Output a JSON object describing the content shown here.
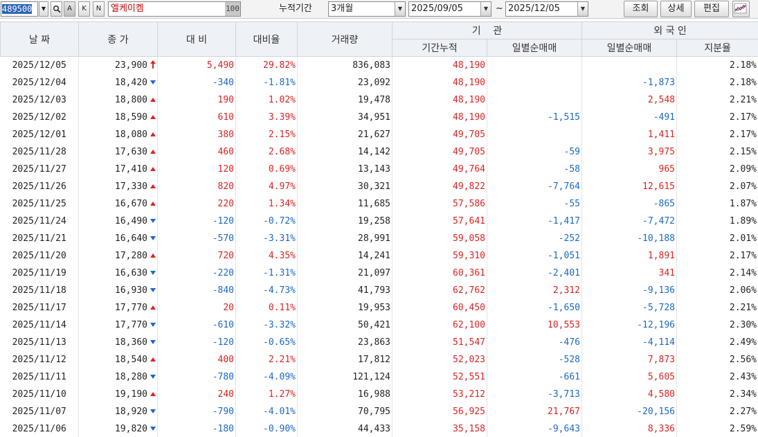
{
  "toolbar": {
    "stock_code": "489500",
    "stock_name": "엘케이켐",
    "name_field_value": "100",
    "btn_search_icon": "magnifier-icon",
    "btn_a": "A",
    "btn_k": "K",
    "btn_n": "N",
    "period_label": "누적기간",
    "period_value": "3개월",
    "from_date": "2025/09/05",
    "tilde": "~",
    "to_date": "2025/12/05",
    "query_button": "조회",
    "detail_button": "상세",
    "edit_button": "편집",
    "chart_icon": "line-chart-icon"
  },
  "columns": {
    "date": "날 짜",
    "close": "종 가",
    "change": "대 비",
    "change_rate": "대비율",
    "volume": "거래량",
    "institution": "기    관",
    "inst_cumulative": "기간누적",
    "inst_daily": "일별순매매",
    "foreign": "외 국 인",
    "foreign_daily": "일별순매매",
    "foreign_holding": "지분율"
  },
  "colors": {
    "up": "#e02020",
    "down": "#1a68c9",
    "header_bg": "#eef1f6"
  },
  "rows": [
    {
      "date": "2025/12/05",
      "close": "23,900",
      "dir": "limit",
      "change": "5,490",
      "rate": "29.82%",
      "volume": "836,083",
      "inst_cum": "48,190",
      "inst_daily": "",
      "frn_daily": "",
      "frn_hold": "2.18%"
    },
    {
      "date": "2025/12/04",
      "close": "18,420",
      "dir": "down",
      "change": "-340",
      "rate": "-1.81%",
      "volume": "23,092",
      "inst_cum": "48,190",
      "inst_daily": "",
      "frn_daily": "-1,873",
      "frn_hold": "2.18%"
    },
    {
      "date": "2025/12/03",
      "close": "18,800",
      "dir": "up",
      "change": "190",
      "rate": "1.02%",
      "volume": "19,478",
      "inst_cum": "48,190",
      "inst_daily": "",
      "frn_daily": "2,548",
      "frn_hold": "2.21%"
    },
    {
      "date": "2025/12/02",
      "close": "18,590",
      "dir": "up",
      "change": "610",
      "rate": "3.39%",
      "volume": "34,951",
      "inst_cum": "48,190",
      "inst_daily": "-1,515",
      "frn_daily": "-491",
      "frn_hold": "2.17%"
    },
    {
      "date": "2025/12/01",
      "close": "18,080",
      "dir": "up",
      "change": "380",
      "rate": "2.15%",
      "volume": "21,627",
      "inst_cum": "49,705",
      "inst_daily": "",
      "frn_daily": "1,411",
      "frn_hold": "2.17%"
    },
    {
      "date": "2025/11/28",
      "close": "17,630",
      "dir": "up",
      "change": "460",
      "rate": "2.68%",
      "volume": "14,142",
      "inst_cum": "49,705",
      "inst_daily": "-59",
      "frn_daily": "3,975",
      "frn_hold": "2.15%"
    },
    {
      "date": "2025/11/27",
      "close": "17,410",
      "dir": "up",
      "change": "120",
      "rate": "0.69%",
      "volume": "13,143",
      "inst_cum": "49,764",
      "inst_daily": "-58",
      "frn_daily": "965",
      "frn_hold": "2.09%"
    },
    {
      "date": "2025/11/26",
      "close": "17,330",
      "dir": "up",
      "change": "820",
      "rate": "4.97%",
      "volume": "30,321",
      "inst_cum": "49,822",
      "inst_daily": "-7,764",
      "frn_daily": "12,615",
      "frn_hold": "2.07%"
    },
    {
      "date": "2025/11/25",
      "close": "16,670",
      "dir": "up",
      "change": "220",
      "rate": "1.34%",
      "volume": "11,685",
      "inst_cum": "57,586",
      "inst_daily": "-55",
      "frn_daily": "-865",
      "frn_hold": "1.87%"
    },
    {
      "date": "2025/11/24",
      "close": "16,490",
      "dir": "down",
      "change": "-120",
      "rate": "-0.72%",
      "volume": "19,258",
      "inst_cum": "57,641",
      "inst_daily": "-1,417",
      "frn_daily": "-7,472",
      "frn_hold": "1.89%"
    },
    {
      "date": "2025/11/21",
      "close": "16,640",
      "dir": "down",
      "change": "-570",
      "rate": "-3.31%",
      "volume": "28,991",
      "inst_cum": "59,058",
      "inst_daily": "-252",
      "frn_daily": "-10,188",
      "frn_hold": "2.01%"
    },
    {
      "date": "2025/11/20",
      "close": "17,280",
      "dir": "up",
      "change": "720",
      "rate": "4.35%",
      "volume": "14,241",
      "inst_cum": "59,310",
      "inst_daily": "-1,051",
      "frn_daily": "1,891",
      "frn_hold": "2.17%"
    },
    {
      "date": "2025/11/19",
      "close": "16,630",
      "dir": "down",
      "change": "-220",
      "rate": "-1.31%",
      "volume": "21,097",
      "inst_cum": "60,361",
      "inst_daily": "-2,401",
      "frn_daily": "341",
      "frn_hold": "2.14%"
    },
    {
      "date": "2025/11/18",
      "close": "16,930",
      "dir": "down",
      "change": "-840",
      "rate": "-4.73%",
      "volume": "41,793",
      "inst_cum": "62,762",
      "inst_daily": "2,312",
      "frn_daily": "-9,136",
      "frn_hold": "2.06%"
    },
    {
      "date": "2025/11/17",
      "close": "17,770",
      "dir": "up",
      "change": "20",
      "rate": "0.11%",
      "volume": "19,953",
      "inst_cum": "60,450",
      "inst_daily": "-1,650",
      "frn_daily": "-5,728",
      "frn_hold": "2.21%"
    },
    {
      "date": "2025/11/14",
      "close": "17,770",
      "dir": "down",
      "change": "-610",
      "rate": "-3.32%",
      "volume": "50,421",
      "inst_cum": "62,100",
      "inst_daily": "10,553",
      "frn_daily": "-12,196",
      "frn_hold": "2.30%"
    },
    {
      "date": "2025/11/13",
      "close": "18,360",
      "dir": "down",
      "change": "-120",
      "rate": "-0.65%",
      "volume": "23,863",
      "inst_cum": "51,547",
      "inst_daily": "-476",
      "frn_daily": "-4,114",
      "frn_hold": "2.49%"
    },
    {
      "date": "2025/11/12",
      "close": "18,540",
      "dir": "up",
      "change": "400",
      "rate": "2.21%",
      "volume": "17,812",
      "inst_cum": "52,023",
      "inst_daily": "-528",
      "frn_daily": "7,873",
      "frn_hold": "2.56%"
    },
    {
      "date": "2025/11/11",
      "close": "18,280",
      "dir": "down",
      "change": "-780",
      "rate": "-4.09%",
      "volume": "121,124",
      "inst_cum": "52,551",
      "inst_daily": "-661",
      "frn_daily": "5,605",
      "frn_hold": "2.43%"
    },
    {
      "date": "2025/11/10",
      "close": "19,190",
      "dir": "up",
      "change": "240",
      "rate": "1.27%",
      "volume": "16,988",
      "inst_cum": "53,212",
      "inst_daily": "-3,713",
      "frn_daily": "4,580",
      "frn_hold": "2.34%"
    },
    {
      "date": "2025/11/07",
      "close": "18,920",
      "dir": "down",
      "change": "-790",
      "rate": "-4.01%",
      "volume": "70,795",
      "inst_cum": "56,925",
      "inst_daily": "21,767",
      "frn_daily": "-20,156",
      "frn_hold": "2.27%"
    },
    {
      "date": "2025/11/06",
      "close": "19,820",
      "dir": "down",
      "change": "-180",
      "rate": "-0.90%",
      "volume": "44,433",
      "inst_cum": "35,158",
      "inst_daily": "-9,643",
      "frn_daily": "8,336",
      "frn_hold": "2.59%"
    }
  ]
}
